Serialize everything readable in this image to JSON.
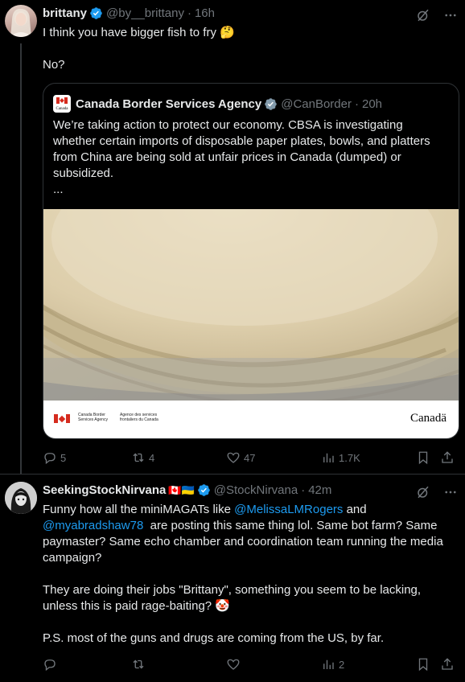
{
  "tweet1": {
    "name": "brittany",
    "handle": "@by__brittany",
    "dot": "·",
    "time": "16h",
    "line1": "I think you have bigger fish to fry 🤔",
    "line2": "No?",
    "quote": {
      "name": "Canada Border Services Agency",
      "handle": "@CanBorder",
      "dot": "·",
      "time": "20h",
      "text": "We’re taking action to protect our economy. CBSA is investigating whether certain imports of disposable paper plates, bowls, and platters from China are being sold at unfair prices in Canada (dumped) or subsidized.\n...",
      "banner_en": "Canada Border\nServices Agency",
      "banner_fr": "Agence des services\nfrontaliers du Canada",
      "wordmark": "Canadä",
      "avatar_text": "Canada"
    },
    "actions": {
      "replies": "5",
      "reposts": "4",
      "likes": "47",
      "views": "1.7K"
    }
  },
  "tweet2": {
    "name": "SeekingStockNirvana",
    "flags": "🇨🇦🇺🇦",
    "handle": "@StockNirvana",
    "dot": "·",
    "time": "42m",
    "p1_a": "Funny how all the miniMAGATs like ",
    "mention1": "@MelissaLMRogers",
    "p1_b": " and ",
    "mention2": "@myabradshaw78",
    "p1_c": "  are posting this same thing lol. Same bot farm? Same paymaster? Same echo chamber and coordination team running the media campaign?",
    "p2": "They are doing their jobs \"Brittany\", something you seem to be lacking, unless this is paid rage-baiting? 🤡",
    "p3": "P.S. most of the guns and drugs are coming from the US, by far.",
    "actions": {
      "views": "2"
    }
  },
  "colors": {
    "verified": "#1d9bf0",
    "link": "#1d9bf0",
    "muted": "#71767b",
    "text": "#e7e9ea",
    "bg": "#000000",
    "canada_red": "#d52b1e"
  }
}
